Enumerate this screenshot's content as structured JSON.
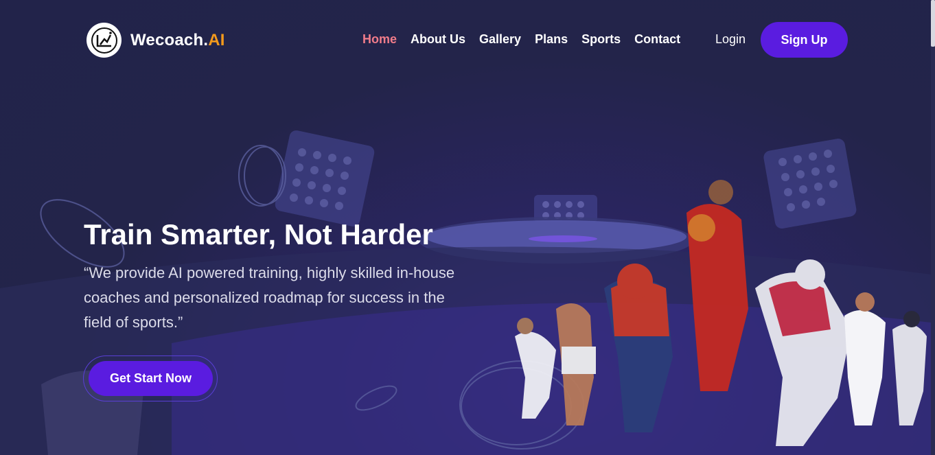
{
  "brand": {
    "name": "Wecoach.",
    "accent": "AI",
    "logo_icon": "wecoach-logo-icon",
    "accent_color": "#f39a1c"
  },
  "nav": {
    "items": [
      {
        "label": "Home",
        "active": true
      },
      {
        "label": "About Us",
        "active": false
      },
      {
        "label": "Gallery",
        "active": false
      },
      {
        "label": "Plans",
        "active": false
      },
      {
        "label": "Sports",
        "active": false
      },
      {
        "label": "Contact",
        "active": false
      }
    ],
    "active_color": "#f07c8a"
  },
  "auth": {
    "login_label": "Login",
    "signup_label": "Sign Up"
  },
  "hero": {
    "title": "Train Smarter, Not Harder",
    "description": "“We provide AI powered training, highly skilled in-house coaches and personalized roadmap for success in the field of sports.”",
    "cta_label": "Get Start Now"
  },
  "colors": {
    "background": "#23244a",
    "primary": "#5a1ce0"
  },
  "illustration": {
    "icons": [
      "stadium-icon",
      "floodlight-icon",
      "coin-icon",
      "trophy-icon",
      "athletes-illustration"
    ]
  }
}
